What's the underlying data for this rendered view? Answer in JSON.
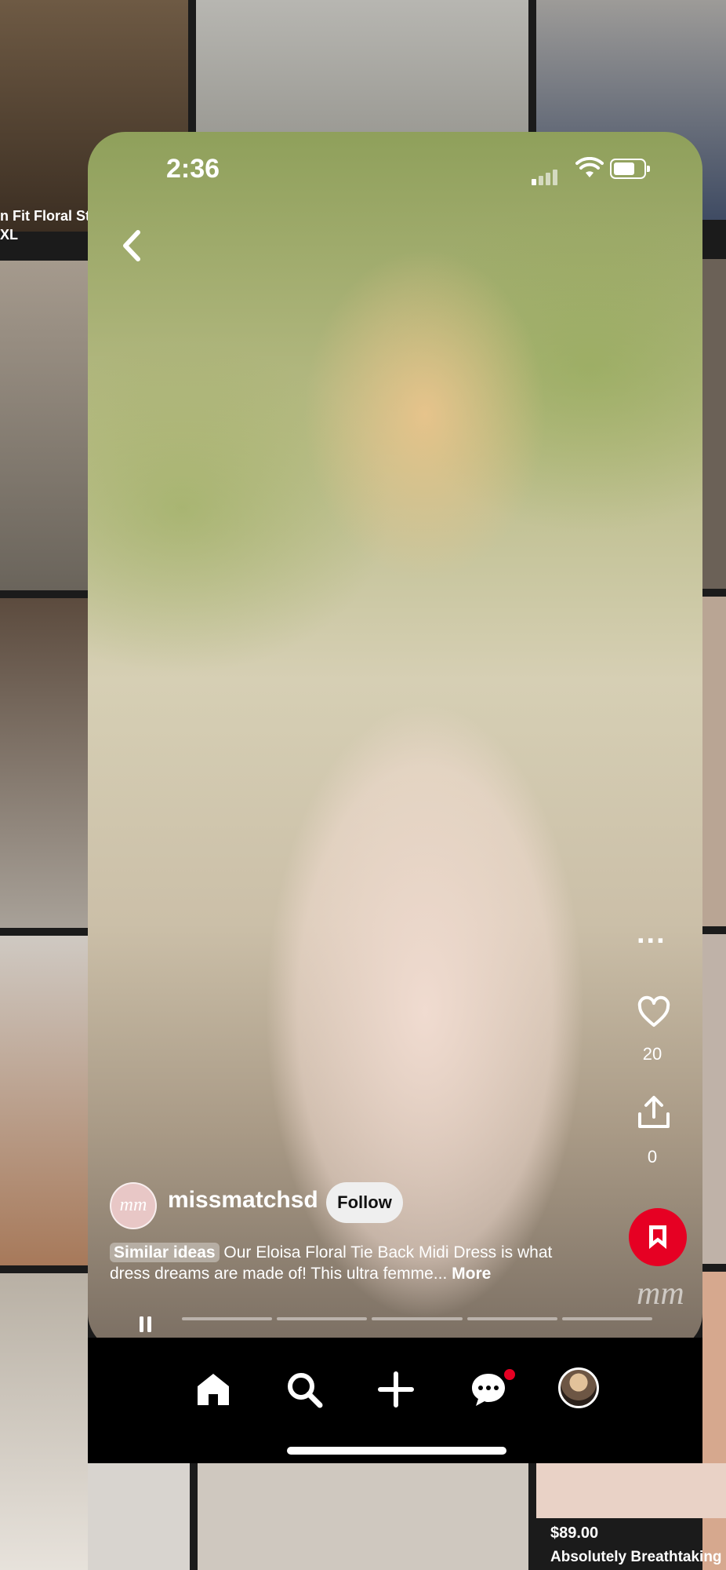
{
  "status_bar": {
    "time": "2:36"
  },
  "background": {
    "tile_caption": "n Fit Floral St\nXL",
    "bottom_right_price": "$89.00",
    "bottom_right_title": "Absolutely Breathtaking"
  },
  "pin": {
    "author": "missmatchsd",
    "author_avatar_text": "mm",
    "follow_label": "Follow",
    "similar_ideas_label": "Similar ideas",
    "description": "Our Eloisa Floral Tie Back Midi Dress is what dress dreams are made of! This ultra femme...",
    "more_label": "More",
    "like_count": "20",
    "share_count": "0",
    "more_options": "...",
    "watermark": "mm",
    "progress_segments": 5
  },
  "nav": {
    "items": [
      "home-icon",
      "search-icon",
      "create-icon",
      "messages-icon",
      "profile-avatar"
    ],
    "messages_badge_color": "#e60023"
  },
  "colors": {
    "save_button": "#e60023"
  }
}
